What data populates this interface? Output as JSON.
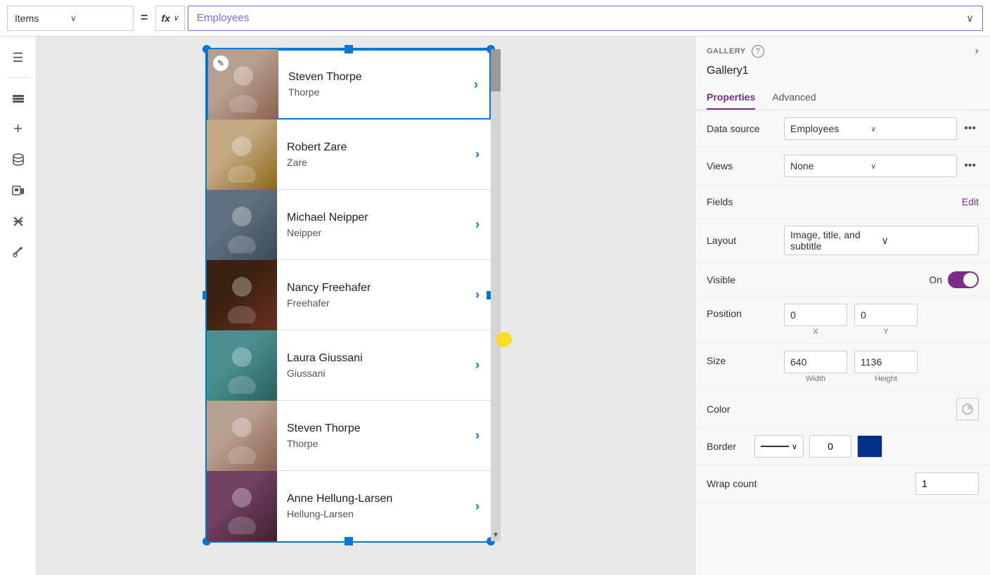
{
  "topbar": {
    "items_label": "Items",
    "equals": "=",
    "fx_label": "fx",
    "formula_value": "Employees",
    "chevron": "∨"
  },
  "sidebar": {
    "icons": [
      {
        "name": "menu-icon",
        "glyph": "☰"
      },
      {
        "name": "layers-icon",
        "glyph": "⊞"
      },
      {
        "name": "add-icon",
        "glyph": "+"
      },
      {
        "name": "database-icon",
        "glyph": "⬟"
      },
      {
        "name": "media-icon",
        "glyph": "▶"
      },
      {
        "name": "tools-icon",
        "glyph": "⚙"
      }
    ]
  },
  "gallery": {
    "items": [
      {
        "title": "Steven Thorpe",
        "subtitle": "Thorpe",
        "photo_color": "p1"
      },
      {
        "title": "Robert Zare",
        "subtitle": "Zare",
        "photo_color": "p2"
      },
      {
        "title": "Michael Neipper",
        "subtitle": "Neipper",
        "photo_color": "p3"
      },
      {
        "title": "Nancy Freehafer",
        "subtitle": "Freehafer",
        "photo_color": "p4"
      },
      {
        "title": "Laura Giussani",
        "subtitle": "Giussani",
        "photo_color": "p5"
      },
      {
        "title": "Steven Thorpe",
        "subtitle": "Thorpe",
        "photo_color": "p6"
      },
      {
        "title": "Anne Hellung-Larsen",
        "subtitle": "Hellung-Larsen",
        "photo_color": "p7"
      }
    ]
  },
  "rightpanel": {
    "section_label": "GALLERY",
    "help_icon": "?",
    "expand_icon": "›",
    "gallery_name": "Gallery1",
    "tabs": [
      {
        "label": "Properties",
        "active": true
      },
      {
        "label": "Advanced",
        "active": false
      }
    ],
    "properties": {
      "data_source_label": "Data source",
      "data_source_value": "Employees",
      "views_label": "Views",
      "views_value": "None",
      "fields_label": "Fields",
      "fields_edit": "Edit",
      "layout_label": "Layout",
      "layout_value": "Image, title, and subtitle",
      "visible_label": "Visible",
      "visible_on": "On",
      "position_label": "Position",
      "position_x": "0",
      "position_y": "0",
      "position_x_label": "X",
      "position_y_label": "Y",
      "size_label": "Size",
      "size_width": "640",
      "size_height": "1136",
      "size_width_label": "Width",
      "size_height_label": "Height",
      "color_label": "Color",
      "border_label": "Border",
      "border_num": "0",
      "wrapcount_label": "Wrap count",
      "wrapcount_value": "1"
    }
  }
}
